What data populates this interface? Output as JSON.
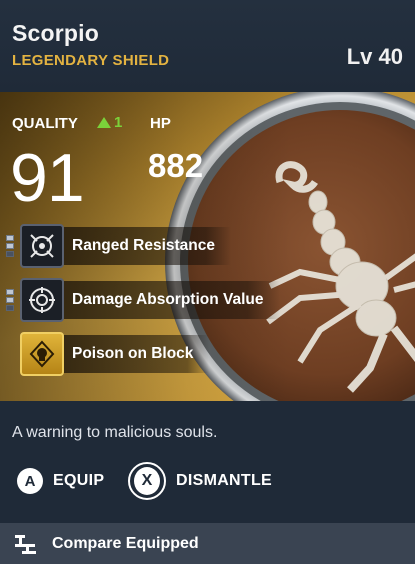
{
  "item": {
    "name": "Scorpio",
    "rarity": "LEGENDARY SHIELD",
    "level": "Lv 40",
    "description": "A warning to malicious souls."
  },
  "stats": {
    "quality_label": "QUALITY",
    "quality_delta": "1",
    "quality_value": "91",
    "hp_label": "HP",
    "hp_value": "882"
  },
  "perks": [
    {
      "label": "Ranged Resistance",
      "icon": "ranged-resistance-icon",
      "tier": "silver"
    },
    {
      "label": "Damage Absorption Value",
      "icon": "damage-absorption-icon",
      "tier": "silver"
    },
    {
      "label": "Poison on Block",
      "icon": "poison-on-block-icon",
      "tier": "gold"
    }
  ],
  "actions": {
    "equip_button": "A",
    "equip_label": "EQUIP",
    "dismantle_button": "X",
    "dismantle_label": "DISMANTLE"
  },
  "footer": {
    "compare_label": "Compare Equipped",
    "compare_icon": "compare-icon"
  },
  "colors": {
    "rarity": "#e3b341",
    "delta": "#7bd23a",
    "background": "#1f2a38",
    "footer": "#3a4452"
  }
}
